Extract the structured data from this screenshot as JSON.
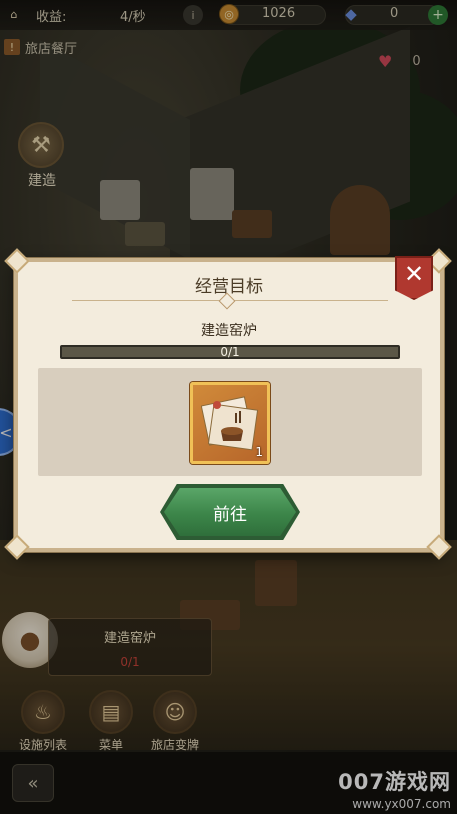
{
  "hud": {
    "income_label": "收益:",
    "income_rate": "4/秒",
    "coins": "1026",
    "gems": "0",
    "location": "旅店餐厅",
    "hearts": "0"
  },
  "build_button": {
    "label": "建造"
  },
  "dialog": {
    "title": "经营目标",
    "goal_name": "建造窑炉",
    "progress_text": "0/1",
    "progress_fraction": 0,
    "reward": {
      "icon": "kiln-blueprint-icon",
      "count": "1"
    },
    "go_button_label": "前往"
  },
  "task_widget": {
    "name": "建造窑炉",
    "progress": "0/1"
  },
  "bottom_menu": {
    "items": [
      {
        "label": "设施列表",
        "icon": "stew-pot-icon"
      },
      {
        "label": "菜单",
        "icon": "menu-book-icon"
      },
      {
        "label": "旅店变牌",
        "icon": "chef-icon"
      }
    ]
  },
  "watermark": {
    "brand": "007游戏网",
    "url": "www.yx007.com"
  },
  "colors": {
    "dialog_bg": "#f3ecdd",
    "close_red": "#b0382f",
    "go_green": "#3c8549",
    "progress_track": "#5b5747"
  }
}
